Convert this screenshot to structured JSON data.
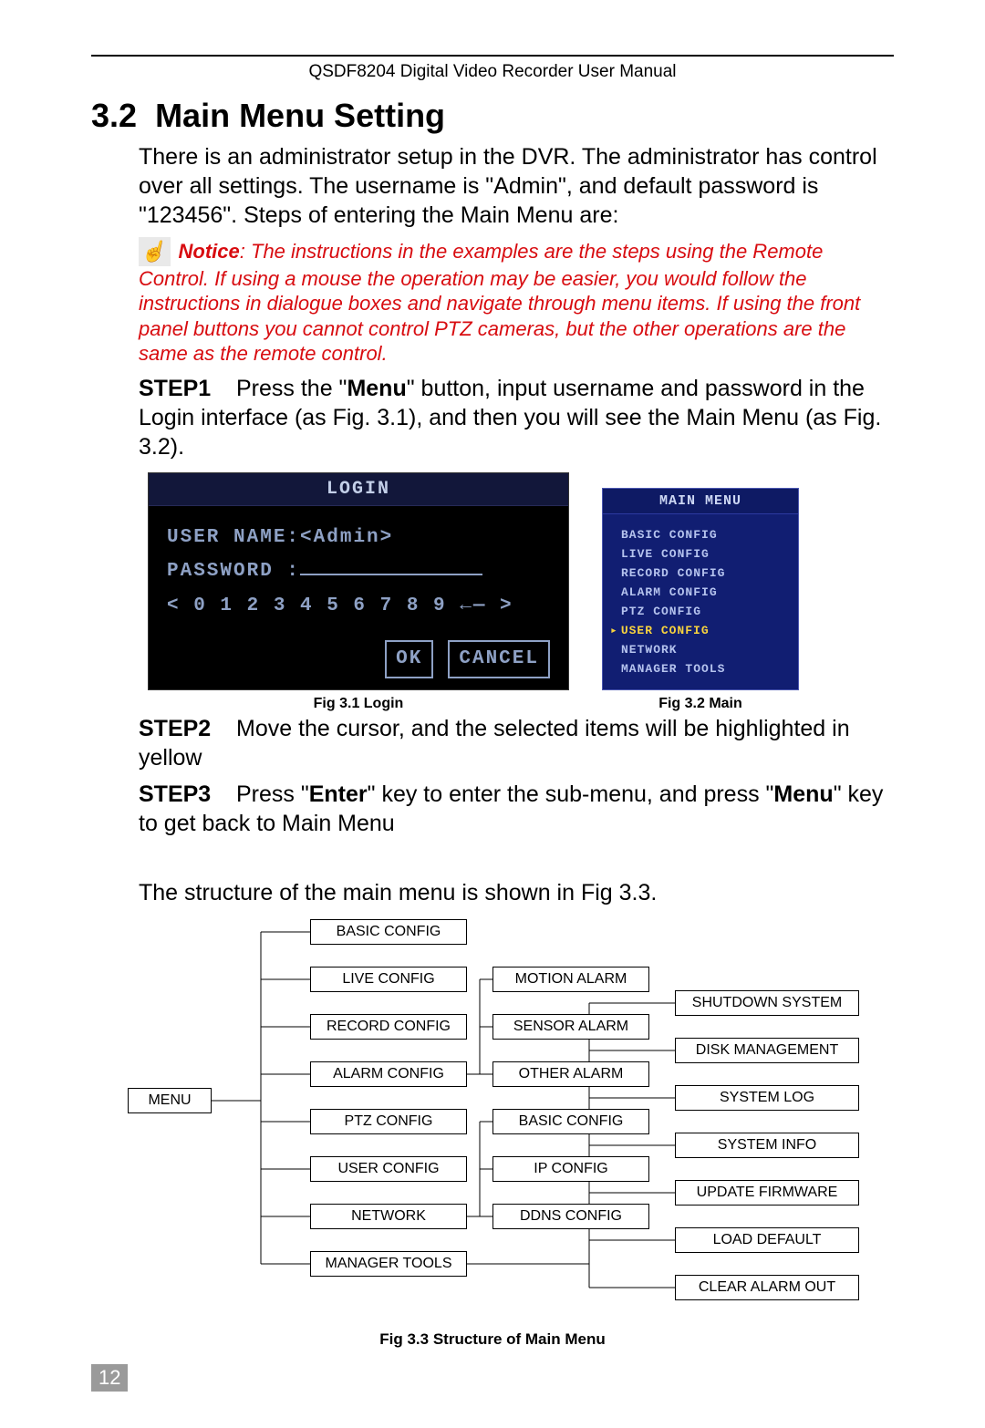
{
  "header": "QSDF8204 Digital Video Recorder User Manual",
  "section": {
    "num": "3.2",
    "title": "Main Menu Setting"
  },
  "p_intro": "There is an administrator setup in the DVR. The administrator has control over all settings. The username is \"Admin\", and default password is \"123456\". Steps of entering the Main Menu are:",
  "notice_label": "Notice",
  "notice_text": ": The instructions in the examples are the steps using the Remote Control. If using a mouse the operation may be easier, you would follow the instructions in dialogue boxes and navigate through menu items. If using the front panel buttons you cannot control PTZ cameras, but the other operations are the same as the remote control.",
  "step1": {
    "label": "STEP1",
    "pre": "Press the \"",
    "kw": "Menu",
    "post": "\" button, input username and password in the Login interface (as Fig. 3.1), and then you will see the Main Menu (as Fig. 3.2)."
  },
  "login": {
    "title": "LOGIN",
    "user_label": "USER NAME:",
    "user_value": "<Admin>",
    "pass_label": "PASSWORD :",
    "digits": "< 0 1 2 3 4 5 6 7 8 9 ←— >",
    "ok": "OK",
    "cancel": "CANCEL",
    "caption": "Fig 3.1 Login"
  },
  "mainmenu": {
    "title": "MAIN  MENU",
    "items": [
      "BASIC CONFIG",
      "LIVE CONFIG",
      "RECORD CONFIG",
      "ALARM CONFIG",
      "PTZ CONFIG",
      "USER CONFIG",
      "NETWORK",
      "MANAGER TOOLS"
    ],
    "selected_index": 5,
    "caption": "Fig 3.2 Main"
  },
  "step2": {
    "label": "STEP2",
    "text": "Move the cursor, and the selected items will be highlighted in yellow"
  },
  "step3": {
    "label": "STEP3",
    "pre": "Press \"",
    "kw1": "Enter",
    "mid": "\" key to enter the sub-menu, and press \"",
    "kw2": "Menu",
    "post": "\" key to get back to Main Menu"
  },
  "p_struct": "The structure of the main menu is shown in Fig 3.3.",
  "diagram": {
    "root": "MENU",
    "col1": [
      "BASIC CONFIG",
      "LIVE CONFIG",
      "RECORD CONFIG",
      "ALARM CONFIG",
      "PTZ CONFIG",
      "USER CONFIG",
      "NETWORK",
      "MANAGER TOOLS"
    ],
    "col2": [
      "MOTION ALARM",
      "SENSOR ALARM",
      "OTHER ALARM",
      "BASIC CONFIG",
      "IP CONFIG",
      "DDNS CONFIG"
    ],
    "col3": [
      "SHUTDOWN SYSTEM",
      "DISK MANAGEMENT",
      "SYSTEM LOG",
      "SYSTEM INFO",
      "UPDATE FIRMWARE",
      "LOAD DEFAULT",
      "CLEAR ALARM OUT"
    ],
    "caption": "Fig 3.3 Structure of Main Menu"
  },
  "page_number": "12"
}
